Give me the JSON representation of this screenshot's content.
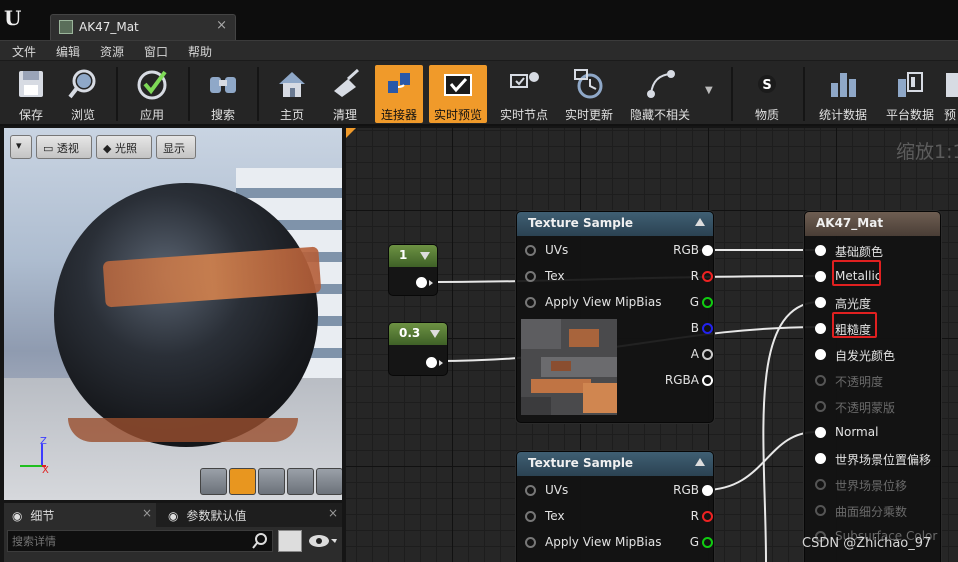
{
  "window": {
    "tab_title": "AK47_Mat",
    "close_glyph": "×"
  },
  "menu": [
    "文件",
    "编辑",
    "资源",
    "窗口",
    "帮助"
  ],
  "toolbar": [
    {
      "label": "保存",
      "icon": "save-icon"
    },
    {
      "label": "浏览",
      "icon": "browse-icon"
    },
    {
      "label": "应用",
      "icon": "apply-icon"
    },
    {
      "label": "搜索",
      "icon": "search-icon"
    },
    {
      "label": "主页",
      "icon": "home-icon"
    },
    {
      "label": "清理",
      "icon": "clean-icon"
    },
    {
      "label": "连接器",
      "icon": "connector-icon",
      "active": true
    },
    {
      "label": "实时预览",
      "icon": "live-preview-icon",
      "active": true
    },
    {
      "label": "实时节点",
      "icon": "live-nodes-icon"
    },
    {
      "label": "实时更新",
      "icon": "live-update-icon"
    },
    {
      "label": "隐藏不相关",
      "icon": "hide-unrelated-icon"
    },
    {
      "label": "物质",
      "icon": "substance-icon"
    },
    {
      "label": "统计数据",
      "icon": "stats-icon"
    },
    {
      "label": "平台数据",
      "icon": "platform-stats-icon"
    },
    {
      "label": "预",
      "icon": "preview-icon"
    }
  ],
  "viewport": {
    "buttons": {
      "perspective": "透视",
      "lighting": "光照",
      "show": "显示"
    },
    "axis": {
      "x": "X",
      "z": "Z"
    }
  },
  "details": {
    "tab_details": "细节",
    "tab_params": "参数默认值",
    "search_placeholder": "搜索详情"
  },
  "graph": {
    "zoom_label": "缩放1:1",
    "constants": [
      {
        "value": "1"
      },
      {
        "value": "0.3"
      }
    ],
    "texture_node": {
      "title": "Texture Sample",
      "inputs": [
        "UVs",
        "Tex",
        "Apply View MipBias"
      ],
      "outputs": [
        "RGB",
        "R",
        "G",
        "B",
        "A",
        "RGBA"
      ]
    },
    "texture_node_2": {
      "title": "Texture Sample",
      "inputs": [
        "UVs",
        "Tex",
        "Apply View MipBias"
      ],
      "outputs": [
        "RGB",
        "R",
        "G"
      ]
    },
    "material_node": {
      "title": "AK47_Mat",
      "pins": [
        {
          "label": "基础颜色",
          "enabled": true
        },
        {
          "label": "Metallic",
          "enabled": true,
          "highlighted": true
        },
        {
          "label": "高光度",
          "enabled": true
        },
        {
          "label": "粗糙度",
          "enabled": true,
          "highlighted": true
        },
        {
          "label": "自发光颜色",
          "enabled": true
        },
        {
          "label": "不透明度",
          "enabled": false
        },
        {
          "label": "不透明蒙版",
          "enabled": false
        },
        {
          "label": "Normal",
          "enabled": true
        },
        {
          "label": "世界场景位置偏移",
          "enabled": true
        },
        {
          "label": "世界场景位移",
          "enabled": false
        },
        {
          "label": "曲面细分乘数",
          "enabled": false
        },
        {
          "label": "Subsurface Color",
          "enabled": false
        }
      ]
    }
  },
  "watermark": "CSDN @Zhichao_97",
  "colors": {
    "accent": "#f09a2a",
    "highlight": "#e02020",
    "texture_header": "#3f5f73",
    "material_header": "#6e5e52",
    "constant_header": "#6d9243"
  }
}
